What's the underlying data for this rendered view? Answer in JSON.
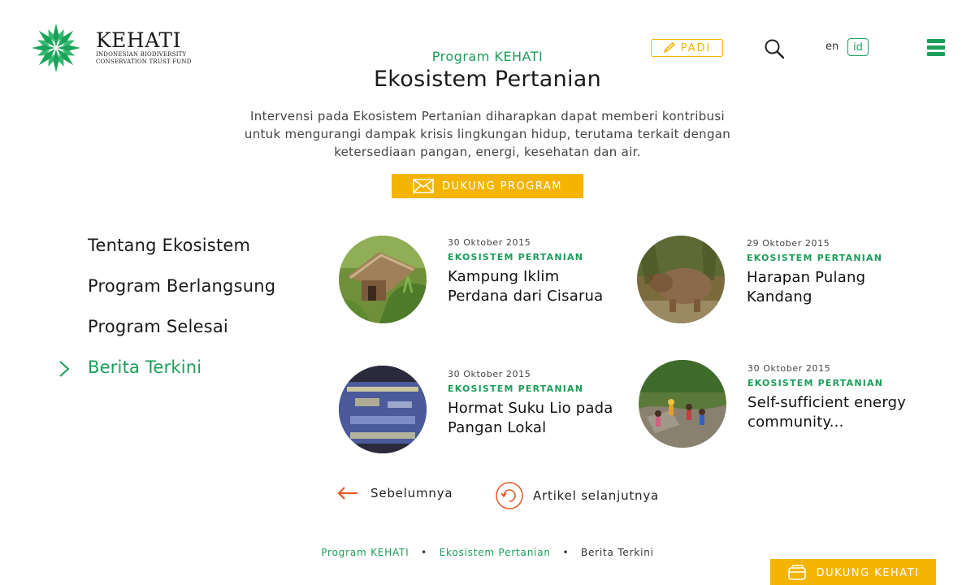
{
  "header": {
    "logo_name": "KEHATI",
    "logo_sub_1": "Indonesian Biodiversity",
    "logo_sub_2": "Conservation Trust Fund",
    "padi_label": "PADI",
    "lang_en": "en",
    "lang_id": "id"
  },
  "hero": {
    "eyebrow": "Program KEHATI",
    "title": "Ekosistem Pertanian",
    "description": "Intervensi pada Ekosistem Pertanian diharapkan dapat memberi kontribusi untuk mengurangi dampak krisis lingkungan hidup, terutama terkait dengan ketersediaan pangan, energi, kesehatan dan air.",
    "support_label": "DUKUNG PROGRAM"
  },
  "sidenav": {
    "items": [
      {
        "label": "Tentang Ekosistem",
        "active": false
      },
      {
        "label": "Program Berlangsung",
        "active": false
      },
      {
        "label": "Program Selesai",
        "active": false
      },
      {
        "label": "Berita Terkini",
        "active": true
      }
    ]
  },
  "articles": [
    {
      "date": "30 Oktober 2015",
      "category": "EKOSISTEM PERTANIAN",
      "title": "Kampung Iklim Perdana dari Cisarua",
      "thumb": "farm-hut-image"
    },
    {
      "date": "29 Oktober 2015",
      "category": "EKOSISTEM PERTANIAN",
      "title": "Harapan Pulang Kandang",
      "thumb": "rhino-image"
    },
    {
      "date": "30 Oktober 2015",
      "category": "EKOSISTEM PERTANIAN",
      "title": "Hormat Suku Lio pada Pangan Lokal",
      "thumb": "presentation-image"
    },
    {
      "date": "30 Oktober 2015",
      "category": "EKOSISTEM PERTANIAN",
      "title": "Self-sufficient energy community...",
      "thumb": "river-people-image"
    }
  ],
  "pagination": {
    "prev_label": "Sebelumnya",
    "next_label": "Artikel selanjutnya"
  },
  "breadcrumb": {
    "level1": "Program KEHATI",
    "level2": "Ekosistem Pertanian",
    "current": "Berita Terkini"
  },
  "footer": {
    "support_kehati_label": "DUKUNG KEHATI"
  },
  "colors": {
    "brand_green": "#1a9e5a",
    "accent_yellow": "#f5b400",
    "arrow_orange": "#e8572a"
  }
}
